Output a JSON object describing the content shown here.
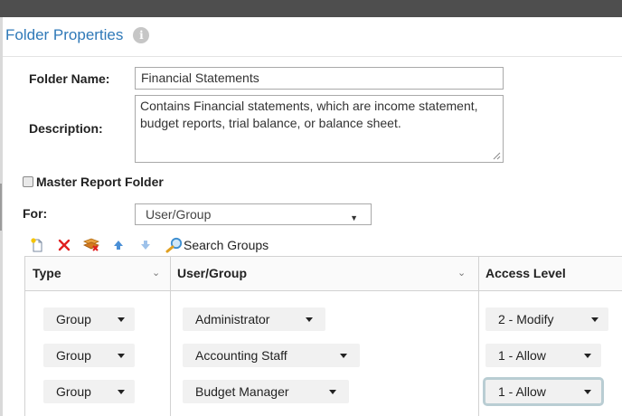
{
  "dialog": {
    "title": "Folder Properties",
    "info_glyph": "i"
  },
  "form": {
    "folder_name_label": "Folder Name:",
    "folder_name_value": "Financial Statements",
    "description_label": "Description:",
    "description_value": "Contains Financial statements, which are income statement, budget reports, trial balance, or balance sheet.",
    "master_report_label": "Master Report Folder",
    "master_report_checked": false,
    "for_label": "For:",
    "for_value": "User/Group"
  },
  "toolbar": {
    "icons": [
      "new-icon",
      "delete-icon",
      "remove-all-icon",
      "move-up-icon",
      "move-down-icon",
      "search-icon"
    ],
    "search_label": "Search Groups"
  },
  "grid": {
    "columns": [
      "Type",
      "User/Group",
      "Access Level"
    ],
    "rows": [
      {
        "type": "Group",
        "user_group": "Administrator",
        "access_level": "2 - Modify"
      },
      {
        "type": "Group",
        "user_group": "Accounting Staff",
        "access_level": "1 - Allow"
      },
      {
        "type": "Group",
        "user_group": "Budget Manager",
        "access_level": "1 - Allow"
      }
    ]
  },
  "colors": {
    "title": "#2f79b8",
    "top_bar": "#4e4e4e",
    "delete_red": "#e02020",
    "arrow_blue": "#4a8fd6",
    "focus_outline": "#b9cdd3"
  }
}
